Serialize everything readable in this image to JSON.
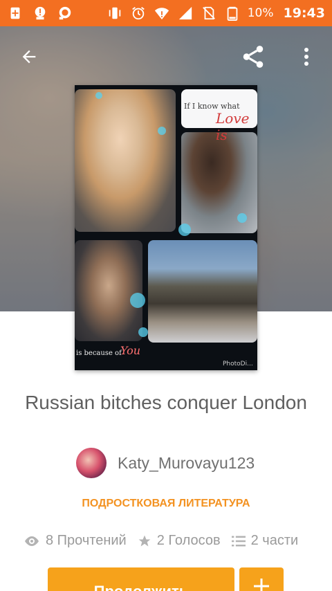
{
  "status_bar": {
    "battery_pct": "10%",
    "time": "19:43",
    "icons": [
      "add-icon",
      "alert-icon",
      "chat-icon",
      "vibrate-icon",
      "alarm-icon",
      "wifi-alert-icon",
      "signal-icon",
      "no-sim-icon",
      "battery-icon"
    ]
  },
  "toolbar": {
    "back": "back-icon",
    "share": "share-icon",
    "more": "more-vert-icon"
  },
  "cover": {
    "text_top_small": "If I know what",
    "text_top_big": "Love is",
    "text_bottom_small": "is because of",
    "text_bottom_big": "You",
    "watermark": "PhotoDi..."
  },
  "story": {
    "title": "Russian bitches conquer London",
    "author": "Katy_Murovayu123",
    "category": "ПОДРОСТКОВАЯ ЛИТЕРАТУРА",
    "reads": "8 Прочтений",
    "votes": "2 Голосов",
    "parts": "2 части"
  },
  "actions": {
    "continue_label": "Продолжить",
    "add_label": "+"
  },
  "colors": {
    "status_bar": "#f36f21",
    "accent": "#f39221",
    "button": "#f6a21b"
  }
}
